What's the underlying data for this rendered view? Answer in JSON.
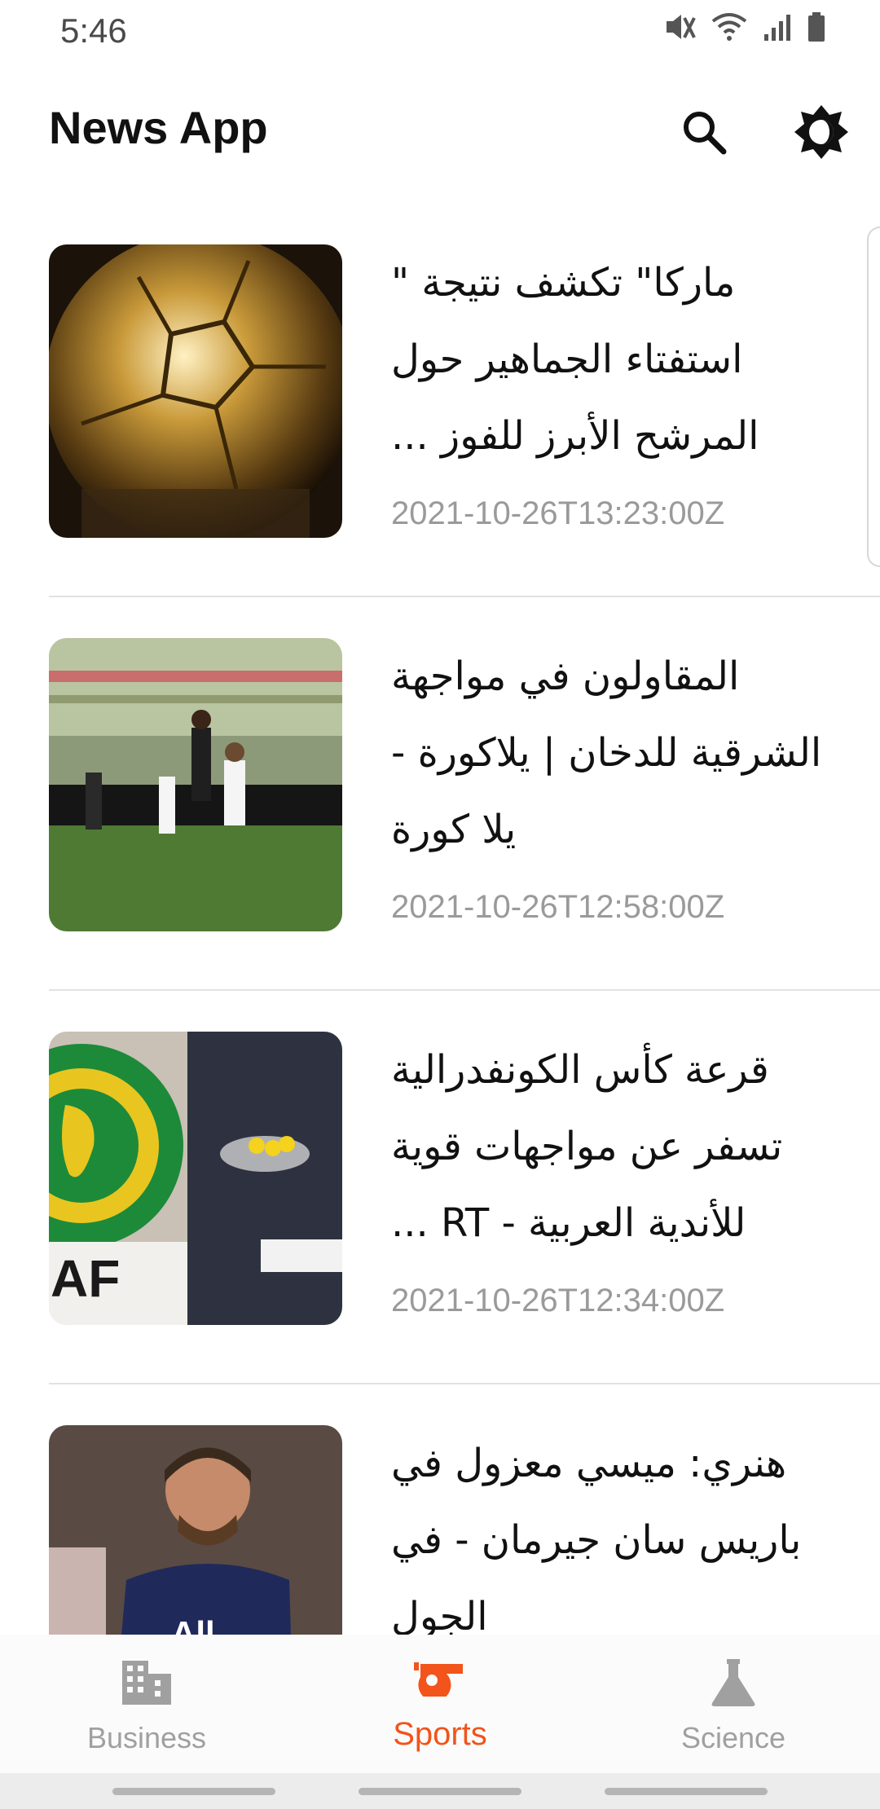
{
  "status": {
    "time": "5:46"
  },
  "header": {
    "title": "News App"
  },
  "articles": [
    {
      "title": "ماركا\" تكشف نتيجة \" استفتاء الجماهير حول المرشح الأبرز للفوز ...",
      "date": "2021-10-26T13:23:00Z"
    },
    {
      "title": "المقاولون في مواجهة الشرقية للدخان | يلاكورة - يلا كورة",
      "date": "2021-10-26T12:58:00Z"
    },
    {
      "title": "قرعة كأس الكونفدرالية تسفر عن مواجهات قوية للأندية العربية - RT ...",
      "date": "2021-10-26T12:34:00Z"
    },
    {
      "title": "هنري: ميسي معزول في باريس سان جيرمان - في الجول",
      "date": ""
    }
  ],
  "nav": {
    "business": "Business",
    "sports": "Sports",
    "science": "Science"
  },
  "colors": {
    "accent": "#f2541b",
    "inactive": "#a0a0a0"
  }
}
